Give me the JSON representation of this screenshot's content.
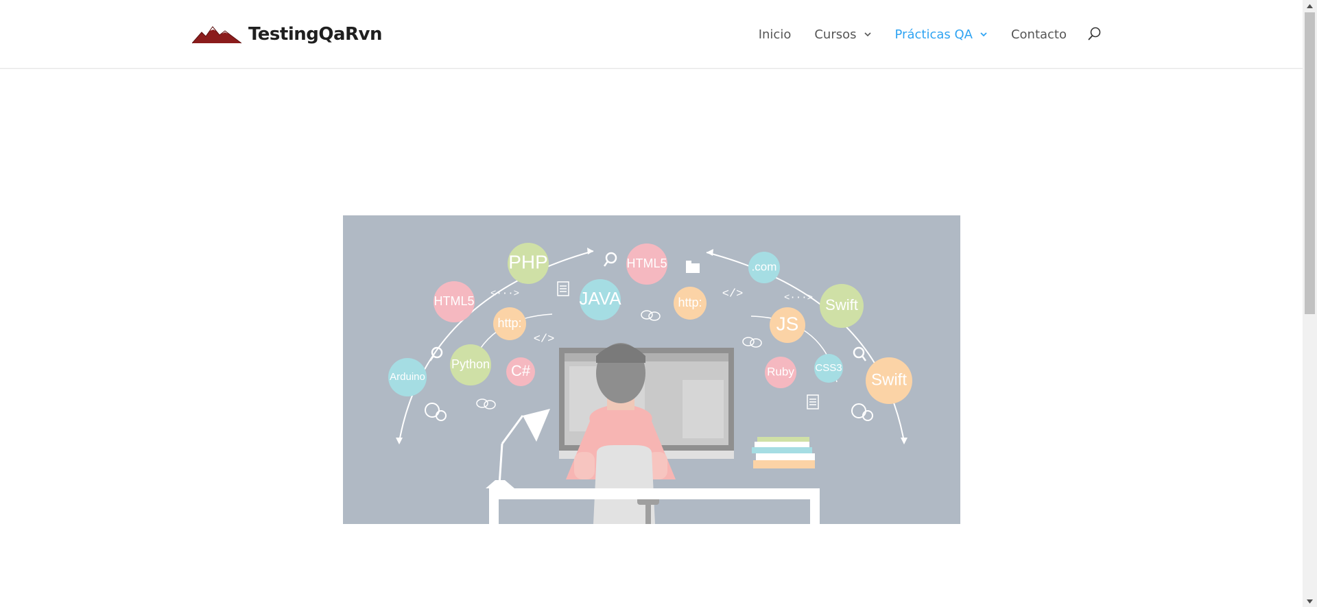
{
  "site": {
    "logo_text": "TestingQaRvn"
  },
  "nav": {
    "items": [
      {
        "label": "Inicio",
        "has_dropdown": false,
        "active": false
      },
      {
        "label": "Cursos",
        "has_dropdown": true,
        "active": false
      },
      {
        "label": "Prácticas QA",
        "has_dropdown": true,
        "active": true
      },
      {
        "label": "Contacto",
        "has_dropdown": false,
        "active": false
      }
    ],
    "search_icon": "search-icon"
  },
  "colors": {
    "accent": "#2ea3f2",
    "nav_text": "#555555",
    "hero_bg": "#b0b9c4",
    "logo_mountain": "#8b1c1c"
  },
  "hero": {
    "bubbles": [
      {
        "label": "PHP",
        "color": "#cfe0a6"
      },
      {
        "label": "HTML5",
        "color": "#f5b8c0"
      },
      {
        "label": "HTML5",
        "color": "#f5b8c0"
      },
      {
        "label": "JAVA",
        "color": "#a5dde3"
      },
      {
        "label": "http:",
        "color": "#fbd3a6"
      },
      {
        "label": "http:",
        "color": "#fbd3a6"
      },
      {
        "label": ".com",
        "color": "#a5dde3"
      },
      {
        "label": "Swift",
        "color": "#cfe0a6"
      },
      {
        "label": "Swift",
        "color": "#fbd3a6"
      },
      {
        "label": "JS",
        "color": "#fbd3a6"
      },
      {
        "label": "Python",
        "color": "#cfe0a6"
      },
      {
        "label": "C#",
        "color": "#f5b8c0"
      },
      {
        "label": "Arduino",
        "color": "#a5dde3"
      },
      {
        "label": "Ruby",
        "color": "#f5b8c0"
      },
      {
        "label": "CSS3",
        "color": "#a5dde3"
      }
    ],
    "glyphs": [
      "<···>",
      "</>",
      "</>",
      "<···>"
    ]
  }
}
